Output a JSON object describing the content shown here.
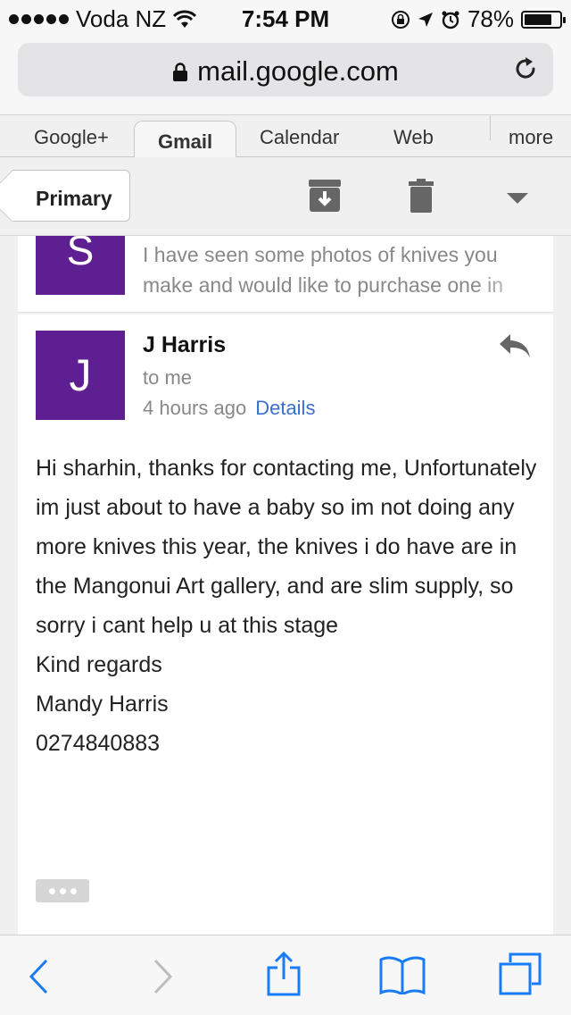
{
  "status_bar": {
    "carrier": "Voda NZ",
    "time": "7:54 PM",
    "battery": "78%",
    "battery_level": 0.78
  },
  "browser": {
    "url": "mail.google.com"
  },
  "tabs": [
    {
      "label": "Google+"
    },
    {
      "label": "Gmail",
      "active": true
    },
    {
      "label": "Calendar"
    },
    {
      "label": "Web"
    },
    {
      "label": "more"
    }
  ],
  "toolbar": {
    "back_label": "Primary"
  },
  "previous_message": {
    "avatar_letter": "S",
    "snippet": "I have seen some photos of knives you make and would like to purchase one in"
  },
  "message": {
    "avatar_letter": "J",
    "sender": "J Harris",
    "recipient": "to me",
    "time": "4 hours ago",
    "details_link": "Details",
    "body": "Hi sharhin, thanks for contacting me, Unfortunately im just about to have a baby so im not doing any more knives this year, the knives i do have are in the Mangonui Art gallery, and are slim supply, so sorry i cant help u at this stage",
    "signoff": "Kind regards",
    "name": "Mandy Harris",
    "phone": "0274840883"
  },
  "colors": {
    "avatar": "#5e1f93",
    "link": "#3b6fce",
    "safari_blue": "#1a7cf4"
  }
}
